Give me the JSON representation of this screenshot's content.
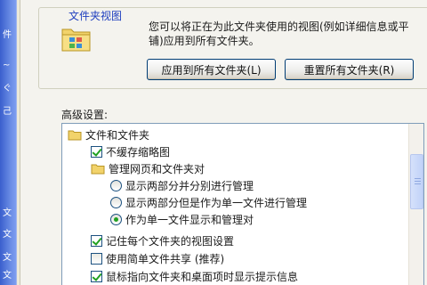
{
  "left_strip": {
    "chars": [
      "件",
      "~",
      "ぐ",
      "己",
      "文",
      "文",
      "文",
      "文"
    ]
  },
  "folder_view": {
    "title": "文件夹视图",
    "description": "您可以将正在为此文件夹使用的视图(例如详细信息或平铺)应用到所有文件夹。",
    "apply_button": "应用到所有文件夹(L)",
    "reset_button": "重置所有文件夹(R)"
  },
  "advanced": {
    "label": "高级设置:",
    "items": [
      {
        "type": "folder",
        "label": "文件和文件夹",
        "indent": 0
      },
      {
        "type": "checkbox",
        "label": "不缓存缩略图",
        "checked": true,
        "indent": 1
      },
      {
        "type": "folder",
        "label": "管理网页和文件夹对",
        "indent": 1
      },
      {
        "type": "radio",
        "label": "显示两部分并分别进行管理",
        "checked": false,
        "indent": 2
      },
      {
        "type": "radio",
        "label": "显示两部分但是作为单一文件进行管理",
        "checked": false,
        "indent": 2
      },
      {
        "type": "radio",
        "label": "作为单一文件显示和管理对",
        "checked": true,
        "indent": 2
      },
      {
        "type": "checkbox",
        "label": "记住每个文件夹的视图设置",
        "checked": true,
        "indent": 1
      },
      {
        "type": "checkbox",
        "label": "使用简单文件共享 (推荐)",
        "checked": false,
        "indent": 1
      },
      {
        "type": "checkbox",
        "label": "鼠标指向文件夹和桌面项时显示提示信息",
        "checked": true,
        "indent": 1
      }
    ]
  },
  "colors": {
    "accent": "#1f3fbf",
    "check": "#21a121",
    "border": "#7f9db9"
  }
}
